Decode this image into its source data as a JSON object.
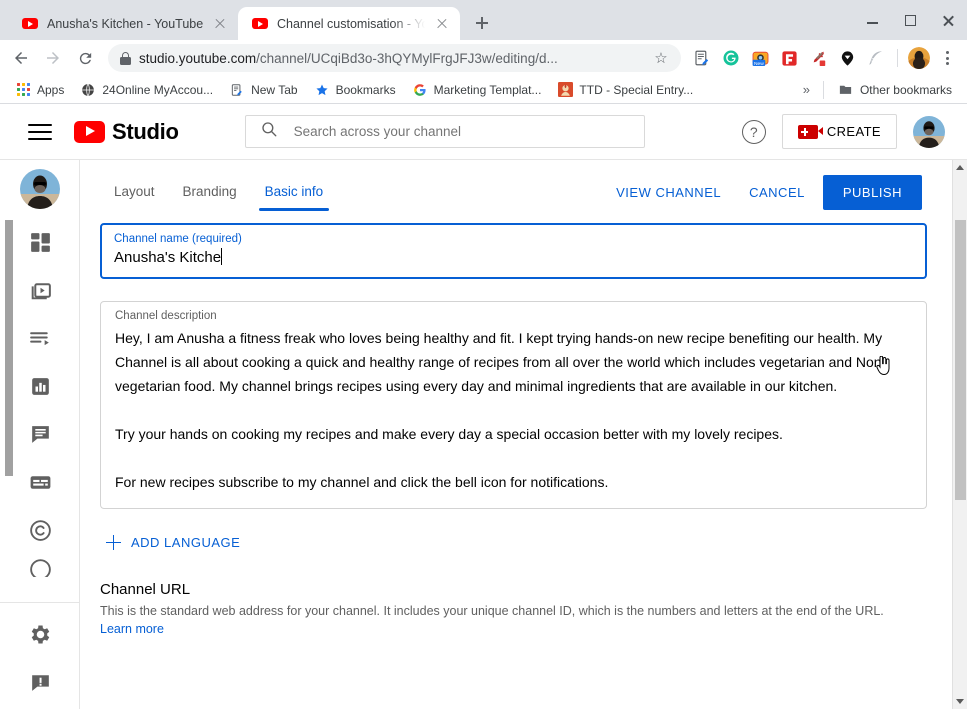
{
  "browser": {
    "tabs": [
      {
        "title": "Anusha's Kitchen - YouTube",
        "favicon": "youtube-icon",
        "active": false
      },
      {
        "title": "Channel customisation - YouTube",
        "favicon": "youtube-icon",
        "active": true
      }
    ],
    "new_tab_label": "+",
    "window_controls": {
      "minimize": "minimize-icon",
      "maximize": "maximize-icon",
      "close": "close-icon"
    },
    "nav": {
      "back": "back-arrow-icon",
      "forward": "forward-arrow-icon",
      "reload": "reload-icon"
    },
    "omnibox": {
      "lock": "lock-icon",
      "domain": "studio.youtube.com",
      "path": "/channel/UCqiBd3o-3hQYMylFrgJFJ3w/editing/d...",
      "bookmark_star": "star-icon"
    },
    "extensions": [
      "notes-edit-icon",
      "grammarly-icon",
      "screen-capture-new-icon",
      "flipboard-icon",
      "eyedropper-icon",
      "pin-icon",
      "feather-icon"
    ],
    "profile": "profile-avatar",
    "menu": "kebab-menu-icon",
    "bookmarks": [
      {
        "label": "Apps",
        "icon": "apps-grid-icon"
      },
      {
        "label": "24Online MyAccou...",
        "icon": "globe-icon"
      },
      {
        "label": "New Tab",
        "icon": "notes-edit-icon"
      },
      {
        "label": "Bookmarks",
        "icon": "star-icon"
      },
      {
        "label": "Marketing Templat...",
        "icon": "google-icon"
      },
      {
        "label": "TTD - Special Entry...",
        "icon": "ttd-icon"
      }
    ],
    "overflow_label": "»",
    "other_bookmarks": {
      "label": "Other bookmarks",
      "icon": "folder-icon"
    }
  },
  "studio": {
    "header": {
      "menu_icon": "hamburger-icon",
      "logo_icon": "youtube-logo-icon",
      "logo_text": "Studio",
      "search_placeholder": "Search across your channel",
      "search_value": "",
      "search_icon": "search-icon",
      "help_icon": "help-icon",
      "create_label": "CREATE",
      "create_icon": "video-camera-icon",
      "avatar": "channel-avatar"
    },
    "sidebar": {
      "avatar": "channel-avatar",
      "items": [
        {
          "name": "dashboard",
          "icon": "dashboard-grid-icon"
        },
        {
          "name": "content",
          "icon": "video-stack-icon"
        },
        {
          "name": "playlists",
          "icon": "playlist-icon"
        },
        {
          "name": "analytics",
          "icon": "bar-chart-icon"
        },
        {
          "name": "comments",
          "icon": "comment-bubble-icon"
        },
        {
          "name": "subtitles",
          "icon": "subtitles-icon"
        },
        {
          "name": "copyright",
          "icon": "copyright-icon"
        }
      ],
      "bottom_items": [
        {
          "name": "settings",
          "icon": "gear-icon"
        },
        {
          "name": "send-feedback",
          "icon": "feedback-icon"
        }
      ]
    },
    "tabs": [
      {
        "label": "Layout",
        "active": false
      },
      {
        "label": "Branding",
        "active": false
      },
      {
        "label": "Basic info",
        "active": true
      }
    ],
    "actions": {
      "view_channel": "VIEW CHANNEL",
      "cancel": "CANCEL",
      "publish": "PUBLISH"
    },
    "channel_name": {
      "label": "Channel name (required)",
      "value": "Anusha's Kitche"
    },
    "channel_description": {
      "label": "Channel description",
      "paragraphs": [
        "Hey, I am Anusha a fitness freak who loves being healthy and fit. I kept trying hands-on new recipe benefiting our health. My Channel is all about cooking a quick and healthy range of recipes from all over the world which includes vegetarian and Non-vegetarian food. My channel brings recipes using every day and minimal ingredients that are available in our kitchen.",
        "Try your hands on cooking my recipes and make every day a special occasion better with my lovely recipes.",
        "For new recipes subscribe to my channel and click the bell icon for notifications."
      ]
    },
    "add_language": {
      "label": "ADD LANGUAGE",
      "icon": "plus-icon"
    },
    "channel_url": {
      "title": "Channel URL",
      "description": "This is the standard web address for your channel. It includes your unique channel ID, which is the numbers and letters at the end of the URL.",
      "learn_more": "Learn more"
    }
  },
  "colors": {
    "accent_blue": "#065fd4",
    "youtube_red": "#ff0000",
    "text_primary": "#030303",
    "text_secondary": "#606060"
  }
}
